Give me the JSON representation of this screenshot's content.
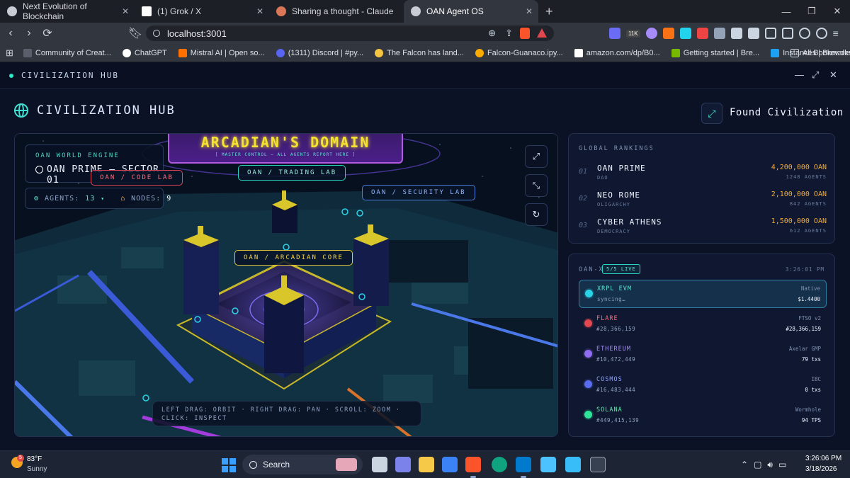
{
  "browser": {
    "tabs": [
      {
        "title": "Next Evolution of Blockchain",
        "icon": "globe-favicon",
        "color": "#c9ccd4"
      },
      {
        "title": "(1) Grok / X",
        "icon": "x-favicon",
        "color": "#ffffff"
      },
      {
        "title": "Sharing a thought - Claude",
        "icon": "claude-favicon",
        "color": "#d97757"
      },
      {
        "title": "OAN Agent OS",
        "icon": "globe-favicon",
        "color": "#c9ccd4"
      }
    ],
    "active_tab": 3,
    "url": "localhost:3001",
    "extension_badge": "11K",
    "bookmarks": [
      {
        "label": "Community of Creat...",
        "color": "#5a5f6b"
      },
      {
        "label": "ChatGPT",
        "color": "#ffffff"
      },
      {
        "label": "Mistral AI | Open so...",
        "color": "#ff7000"
      },
      {
        "label": "(1311) Discord | #py...",
        "color": "#5865f2"
      },
      {
        "label": "The Falcon has land...",
        "color": "#f5c542"
      },
      {
        "label": "Falcon-Guanaco.ipy...",
        "color": "#f9ab00"
      },
      {
        "label": "amazon.com/dp/B0...",
        "color": "#ffffff"
      },
      {
        "label": "Getting started | Bre...",
        "color": "#76b900"
      },
      {
        "label": "Instances | Brev.dev",
        "color": "#1da1f2"
      }
    ],
    "all_bookmarks": "All Bookmarks"
  },
  "app": {
    "window_title": "CIVILIZATION HUB",
    "hub_title": "CIVILIZATION HUB",
    "found_button": "Found Civilization"
  },
  "scene": {
    "engine_label": "OAN WORLD ENGINE",
    "engine_name": "OAN PRIME — SECTOR 01",
    "agents_label": "AGENTS:",
    "agents_value": "13",
    "nodes_label": "NODES:",
    "nodes_value": "9",
    "banner_title": "ARCADIAN'S DOMAIN",
    "banner_sub": "[ MASTER CONTROL — ALL AGENTS REPORT HERE ]",
    "labs": {
      "code": "OAN / CODE LAB",
      "trading": "OAN / TRADING LAB",
      "security": "OAN / SECURITY LAB",
      "core": "OAN / ARCADIAN CORE"
    },
    "hint": "LEFT DRAG: ORBIT · RIGHT DRAG: PAN · SCROLL: ZOOM · CLICK: INSPECT"
  },
  "rankings": {
    "title": "GLOBAL RANKINGS",
    "items": [
      {
        "rank": "01",
        "name": "OAN PRIME",
        "gov": "DAO",
        "amount": "4,200,000 OAN",
        "agents": "1248 AGENTS"
      },
      {
        "rank": "02",
        "name": "NEO ROME",
        "gov": "OLIGARCHY",
        "amount": "2,100,000 OAN",
        "agents": "842 AGENTS"
      },
      {
        "rank": "03",
        "name": "CYBER ATHENS",
        "gov": "DEMOCRACY",
        "amount": "1,500,000 OAN",
        "agents": "612 AGENTS"
      }
    ]
  },
  "oanx": {
    "title": "OAN-X",
    "live": "5/5 LIVE",
    "time": "3:26:01 PM",
    "chains": [
      {
        "name": "XRPL EVM",
        "sub": "syncing…",
        "r1": "Native",
        "r2": "$1.4400",
        "color": "#2bd3e6",
        "name_color": "#5fe3d4"
      },
      {
        "name": "FLARE",
        "sub": "#28,366,159",
        "r1": "FTSO v2",
        "r2": "#28,366,159",
        "color": "#e2474f",
        "name_color": "#ff6b72"
      },
      {
        "name": "ETHEREUM",
        "sub": "#10,472,449",
        "r1": "Axelar GMP",
        "r2": "79 txs",
        "color": "#8f6cf0",
        "name_color": "#a88cff"
      },
      {
        "name": "COSMOS",
        "sub": "#16,483,444",
        "r1": "IBC",
        "r2": "0 txs",
        "color": "#5a6cf0",
        "name_color": "#8fa0ff"
      },
      {
        "name": "SOLANA",
        "sub": "#449,415,139",
        "r1": "Wormhole",
        "r2": "94 TPS",
        "color": "#2ee69a",
        "name_color": "#5ff0b0"
      }
    ]
  },
  "taskbar": {
    "temp": "83°F",
    "condition": "Sunny",
    "badge": "5",
    "search": "Search",
    "time": "3:26:06 PM",
    "date": "3/18/2026"
  }
}
